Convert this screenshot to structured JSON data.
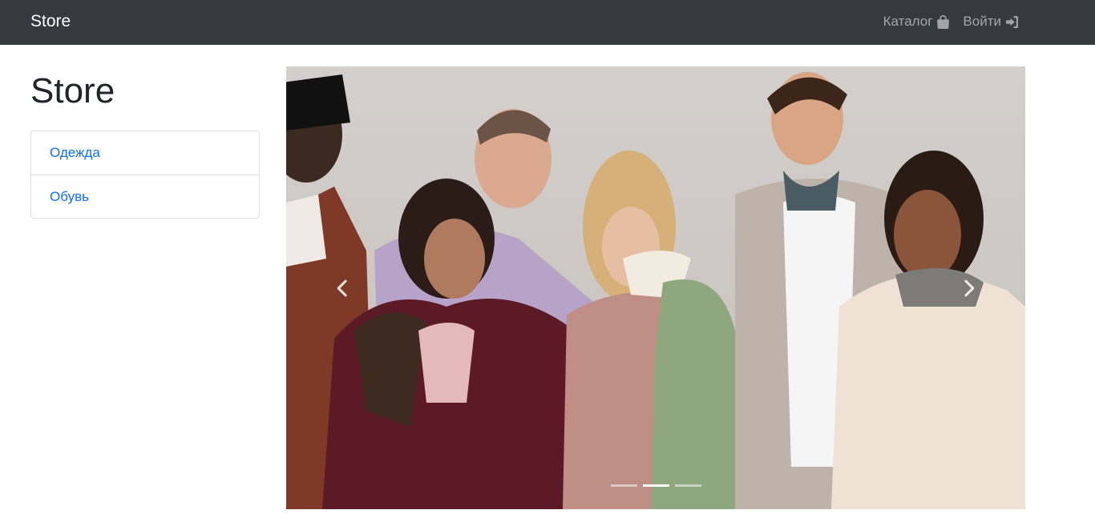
{
  "navbar": {
    "brand": "Store",
    "links": [
      {
        "label": "Каталог",
        "icon": "shopping-bag-icon"
      },
      {
        "label": "Войти",
        "icon": "sign-in-icon"
      }
    ]
  },
  "sidebar": {
    "title": "Store",
    "categories": [
      {
        "label": "Одежда"
      },
      {
        "label": "Обувь"
      }
    ]
  },
  "carousel": {
    "slide_count": 3,
    "active_index": 1,
    "icons": {
      "prev": "chevron-left-icon",
      "next": "chevron-right-icon"
    }
  },
  "colors": {
    "navbar_bg": "#343a40",
    "link": "#0d6efd",
    "nav_link": "rgba(255,255,255,0.55)"
  }
}
